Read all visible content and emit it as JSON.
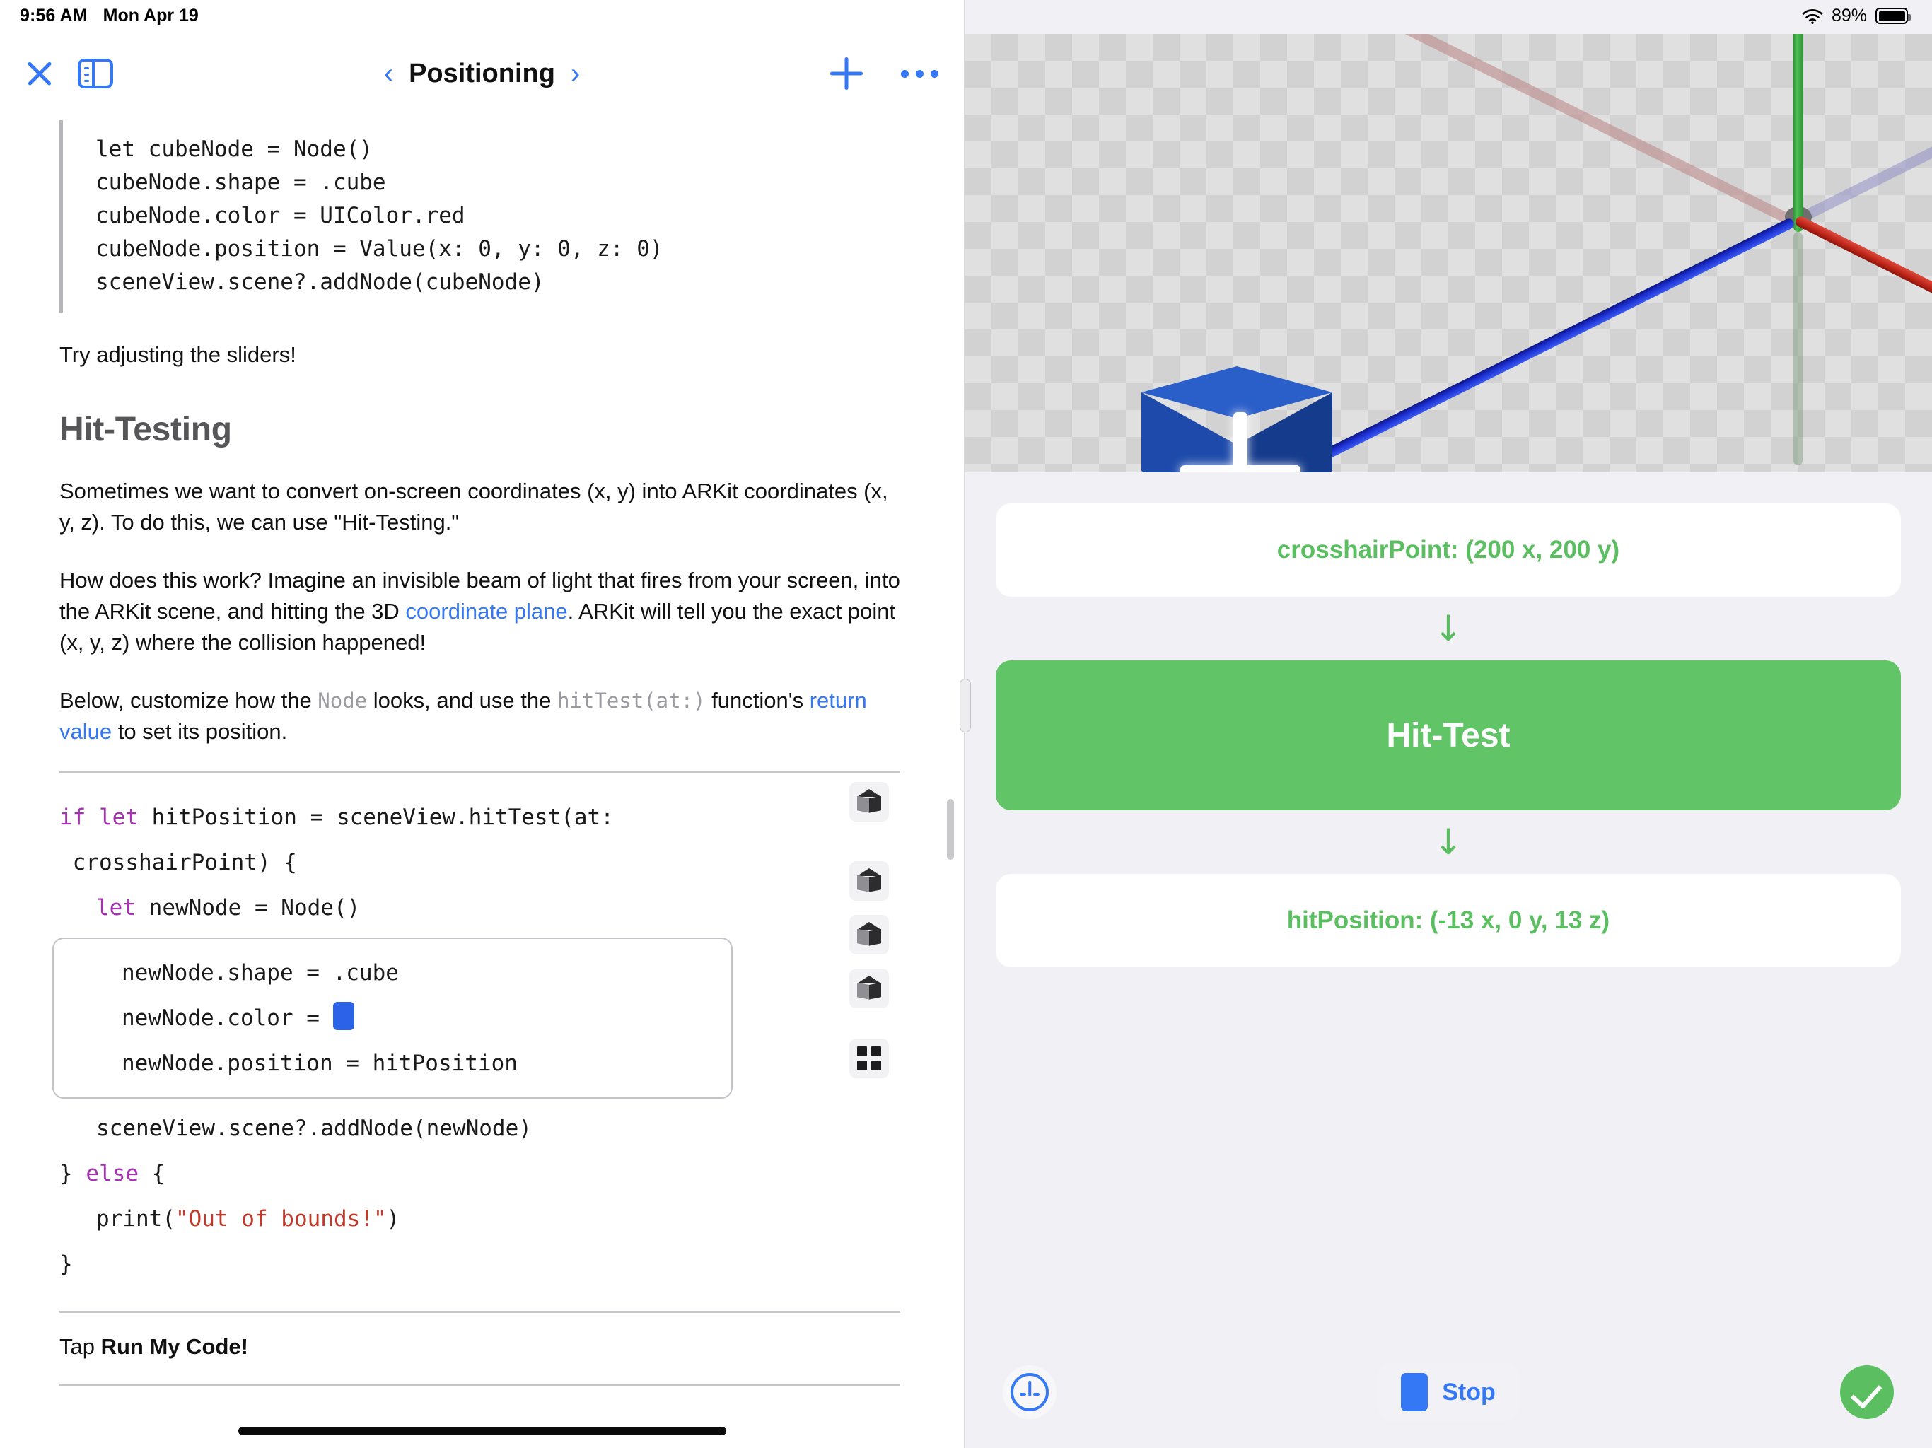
{
  "status_bar": {
    "time": "9:56 AM",
    "date": "Mon Apr 19",
    "battery_percent": "89%",
    "wifi_icon": "wifi-icon",
    "battery_icon": "battery-icon"
  },
  "left_pane": {
    "toolbar": {
      "close_icon": "close-icon",
      "sidebar_toggle_icon": "sidebar-toggle-icon",
      "prev_label": "‹",
      "title": "Positioning",
      "next_label": "›",
      "add_icon": "plus-icon",
      "more_icon": "more-options-icon"
    },
    "quote_code": [
      "let cubeNode = Node()",
      "cubeNode.shape = .cube",
      "cubeNode.color = UIColor.red",
      "cubeNode.position = Value(x: 0, y: 0, z: 0)",
      "sceneView.scene?.addNode(cubeNode)"
    ],
    "para_sliders": "Try adjusting the sliders!",
    "section_heading": "Hit-Testing",
    "para_1": "Sometimes we want to convert on-screen coordinates (x, y) into ARKit coordinates (x, y, z). To do this, we can use \"Hit-Testing.\"",
    "para_2_a": "How does this work? Imagine an invisible beam of light that fires from your screen, into the ARKit scene, and hitting the 3D ",
    "para_2_link": "coordinate plane",
    "para_2_b": ". ARKit will tell you the exact point (x, y, z) where the collision happened!",
    "para_3_a": "Below, customize how the ",
    "para_3_mono1": "Node",
    "para_3_b": " looks, and use the ",
    "para_3_mono2": "hitTest(at:)",
    "para_3_c": " function's ",
    "para_3_link": "return value",
    "para_3_d": " to set its position.",
    "code": {
      "l1_kw1": "if",
      "l1_kw2": "let",
      "l1_rest": " hitPosition = sceneView.hitTest(at:",
      "l2": " crosshairPoint) {",
      "l3_kw": "let",
      "l3_rest": " newNode = Node()",
      "l4": "newNode.shape = .cube",
      "l5_pre": "newNode.color = ",
      "l5_color_swatch": "#2b62e8",
      "l6": "newNode.position = hitPosition",
      "l7": "sceneView.scene?.addNode(newNode)",
      "l8_brace": "} ",
      "l8_kw": "else",
      "l8_rest": " {",
      "l9_pre": "print(",
      "l9_str": "\"Out of bounds!\"",
      "l9_post": ")",
      "l10": "}"
    },
    "shelf_icons": [
      "cube-icon",
      "cube-icon",
      "cube-icon",
      "cube-icon",
      "grid-icon"
    ],
    "tap_prefix": "Tap ",
    "tap_bold": "Run My Code!"
  },
  "right_pane": {
    "scene": {
      "floor": "checkerboard-plane",
      "axes": [
        {
          "name": "y-axis",
          "color": "#3fae46"
        },
        {
          "name": "x-axis",
          "color": "#bb2418"
        },
        {
          "name": "z-axis",
          "color": "#1b2fd0"
        },
        {
          "name": "negative-x-axis",
          "color": "#be8c8c"
        },
        {
          "name": "negative-z-axis",
          "color": "#9696c8"
        }
      ],
      "node": {
        "shape": "cube",
        "color": "#2a5ec9",
        "marker": "crosshair-marker"
      }
    },
    "crosshair_card": "crosshairPoint: (200 x, 200 y)",
    "arrow_1": "↓",
    "hit_test_button": "Hit-Test",
    "arrow_2": "↓",
    "hit_position_card": "hitPosition: (-13 x, 0 y, 13 z)",
    "bottom_bar": {
      "speed_icon": "speedometer-icon",
      "stop_label": "Stop",
      "stop_icon": "stop-square-icon",
      "status_icon": "check-circle-icon"
    },
    "accent_green": "#61c567",
    "accent_blue": "#3478f6"
  }
}
